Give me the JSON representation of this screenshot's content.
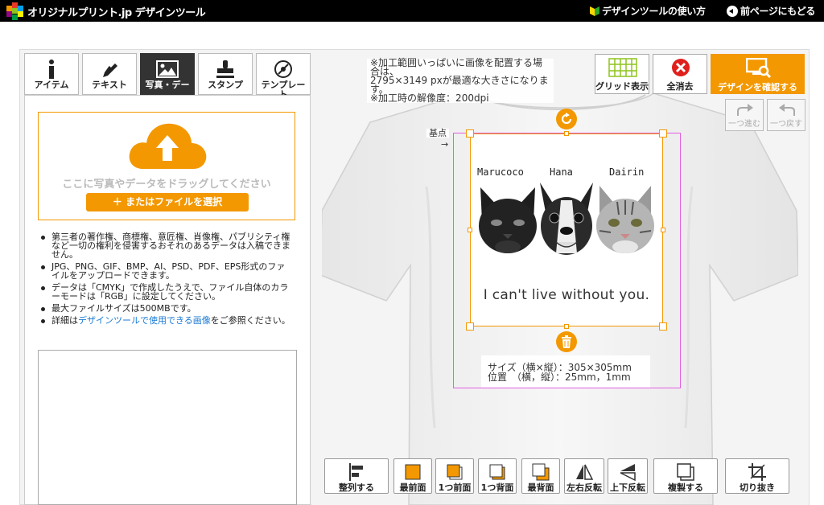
{
  "header": {
    "brand": "オリジナルプリント.jp デザインツール",
    "help_link": "デザインツールの使い方",
    "back_link": "前ページにもどる"
  },
  "left_tabs": [
    {
      "label": "アイテム",
      "icon": "info-icon"
    },
    {
      "label": "テキスト",
      "icon": "pen-icon"
    },
    {
      "label": "写真・デー",
      "icon": "image-icon",
      "active": true
    },
    {
      "label": "スタンプ",
      "icon": "stamp-icon"
    },
    {
      "label": "テンプレート",
      "icon": "template-icon"
    }
  ],
  "upload": {
    "drop_text": "ここに写真やデータをドラッグしてください",
    "select_button": "＋ またはファイルを選択"
  },
  "notes": [
    "第三者の著作権、商標権、意匠権、肖像権、パブリシティ権など一切の権利を侵害するおそれのあるデータは入稿できません。",
    "JPG、PNG、GIF、BMP、AI、PSD、PDF、EPS形式のファイルをアップロードできます。",
    "データは「CMYK」で作成したうえで、ファイル自体のカラーモードは「RGB」に設定してください。",
    "最大ファイルサイズは500MBです。"
  ],
  "note_link": {
    "prefix": "詳細は",
    "link": "デザインツールで使用できる画像",
    "suffix": "をご参照ください。"
  },
  "canvas_info": [
    "※加工範囲いっぱいに画像を配置する場合は、",
    "2795×3149 pxが最適な大きさになります。",
    "※加工時の解像度：200dpi"
  ],
  "top_tools": {
    "grid": "グリッド表示",
    "clear": "全消去",
    "confirm": "デザインを確認する"
  },
  "history": {
    "redo": "一つ進む",
    "undo": "一つ戻す"
  },
  "canvas": {
    "base_point": "基点",
    "base_arrow": "→"
  },
  "design": {
    "names": [
      "Marucoco",
      "Hana",
      "Dairin"
    ],
    "slogan": "I can't live without you."
  },
  "size_info": {
    "size": "サイズ（横×縦）：305×305mm",
    "position": "位置　（横，縦）：25mm，1mm"
  },
  "bottom_tools": [
    {
      "label": "整列する",
      "icon": "align-icon"
    },
    {
      "label": "最前面",
      "icon": "bring-front-icon"
    },
    {
      "label": "1つ前面",
      "icon": "bring-forward-icon"
    },
    {
      "label": "1つ背面",
      "icon": "send-backward-icon"
    },
    {
      "label": "最背面",
      "icon": "send-back-icon"
    },
    {
      "label": "左右反転",
      "icon": "flip-horizontal-icon"
    },
    {
      "label": "上下反転",
      "icon": "flip-vertical-icon"
    },
    {
      "label": "複製する",
      "icon": "duplicate-icon"
    },
    {
      "label": "切り抜き",
      "icon": "crop-icon"
    }
  ],
  "colors": {
    "accent": "#f39800",
    "topbar": "#000000",
    "link": "#1a7ad4",
    "clear_red": "#e0201c",
    "print_area": "#e060e0"
  }
}
